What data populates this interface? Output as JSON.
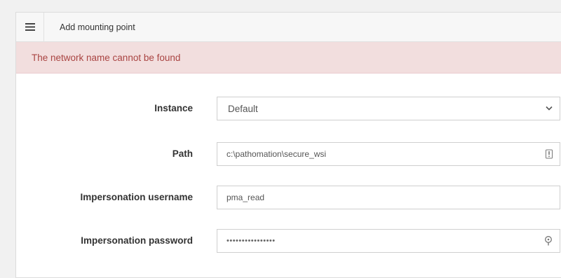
{
  "dialog": {
    "title": "Add mounting point",
    "menu_icon": "hamburger-menu-icon"
  },
  "alert": {
    "message": "The network name cannot be found",
    "background": "#f2dede",
    "text_color": "#a94442"
  },
  "form": {
    "instance": {
      "label": "Instance",
      "value": "Default",
      "icon": "chevron-down-icon"
    },
    "path": {
      "label": "Path",
      "value": "c:\\pathomation\\secure_wsi",
      "icon": "info-icon"
    },
    "username": {
      "label": "Impersonation username",
      "value": "pma_read"
    },
    "password": {
      "label": "Impersonation password",
      "value": "••••••••••••••••",
      "icon": "key-icon"
    }
  }
}
